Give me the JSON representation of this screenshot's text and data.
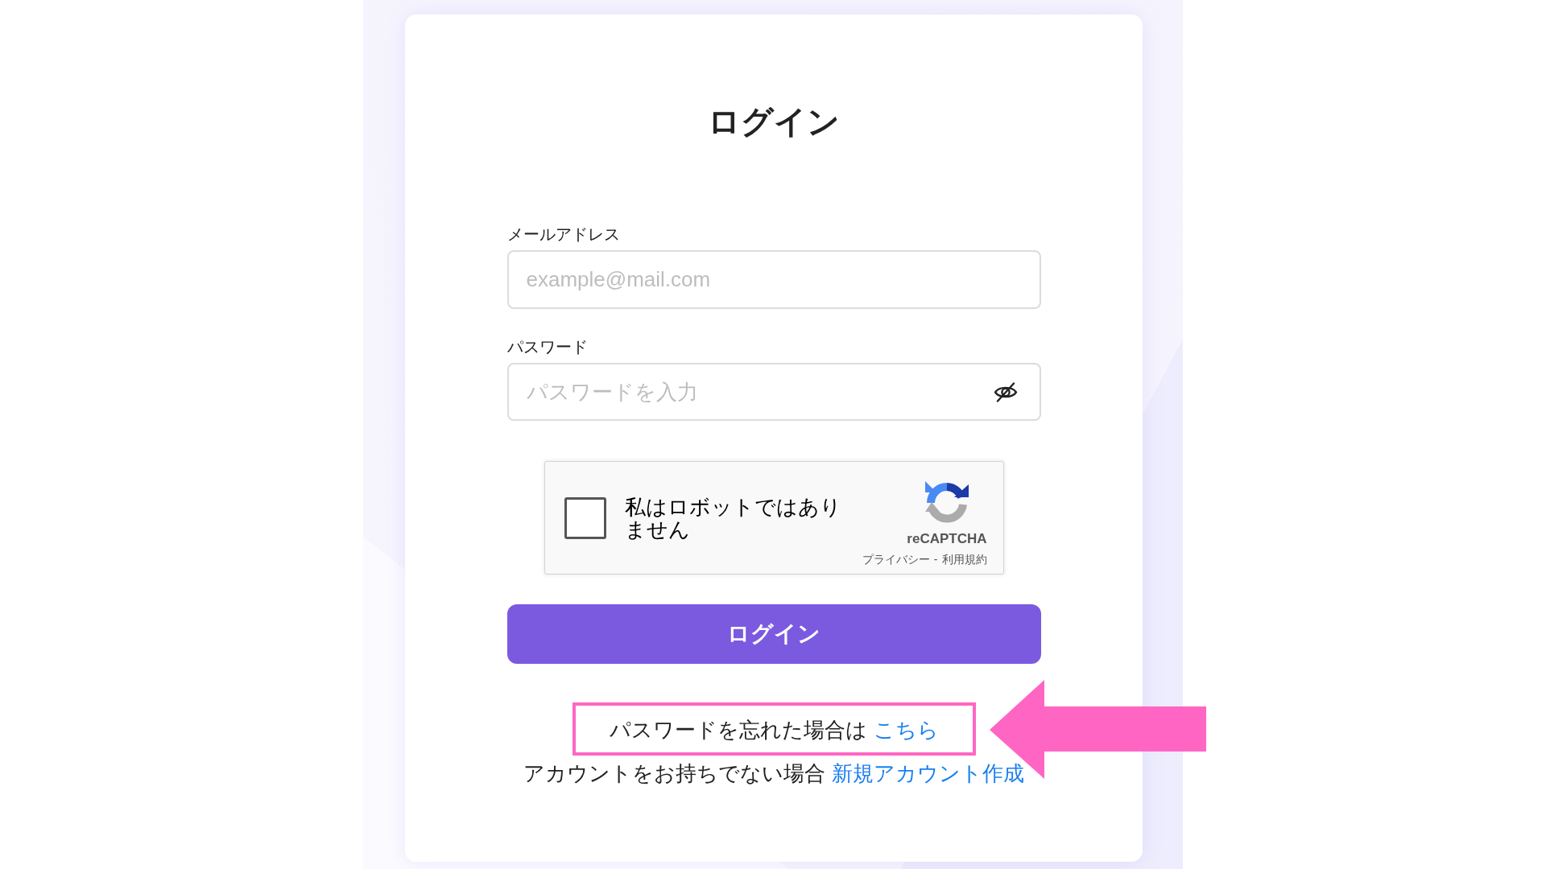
{
  "title": "ログイン",
  "fields": [
    {
      "kind": "email",
      "label": "メールアドレス",
      "placeholder": "example@mail.com"
    },
    {
      "kind": "password",
      "label": "パスワード",
      "placeholder": "パスワードを入力"
    }
  ],
  "recaptcha": {
    "checked": false,
    "label": "私はロボットではありません",
    "brand": "reCAPTCHA",
    "privacy_link": "プライバシー",
    "separator": "-",
    "terms_link": "利用規約"
  },
  "submit_button": "ログイン",
  "links": [
    {
      "text": "パスワードを忘れた場合は",
      "link": "こちら",
      "highlighted": true
    },
    {
      "text": "アカウントをお持ちでない場合",
      "link": "新規アカウント作成",
      "highlighted": false
    }
  ]
}
